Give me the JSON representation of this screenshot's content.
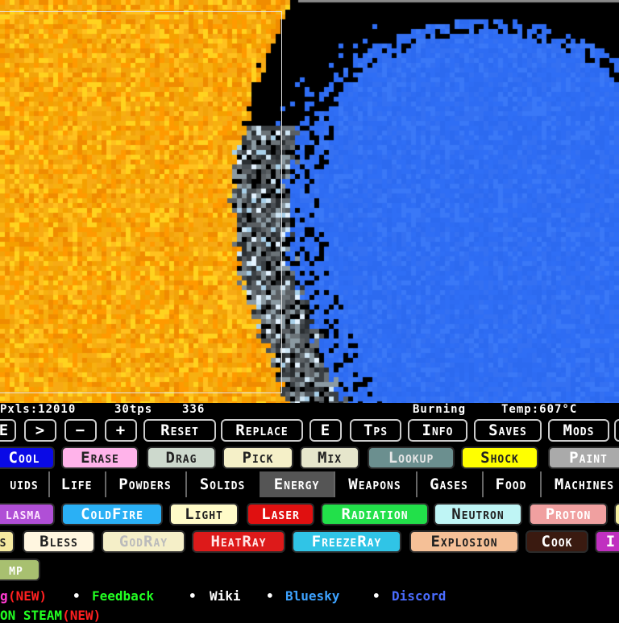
{
  "colors": {
    "fire_orange": "#f5a000",
    "fire_yellow": "#ffd21e",
    "water_blue": "#2f6ef5",
    "smoke_gray": "#5a5f63",
    "ice_light": "#cfe6f5"
  },
  "status": {
    "pixels": "Pxls:12010",
    "tps": "30tps",
    "tick": "336",
    "hover_element": "Burning",
    "temperature": "Temp:607°C"
  },
  "tool_row": {
    "partial_left": "E",
    "next_label": ">",
    "minus_label": "−",
    "plus_label": "+",
    "reset_label": "Reset",
    "replace_label": "Replace",
    "e_label": "E",
    "tps_label": "Tps",
    "info_label": "Info",
    "saves_label": "Saves",
    "mods_label": "Mods"
  },
  "mode_row": [
    {
      "label": "Cool",
      "bg": "#0a0ae6",
      "fg": "#ffffff"
    },
    {
      "label": "Erase",
      "bg": "#ffb3ea",
      "fg": "#222222"
    },
    {
      "label": "Drag",
      "bg": "#cdd9cd",
      "fg": "#222222"
    },
    {
      "label": "Pick",
      "bg": "#f5f0c8",
      "fg": "#222222"
    },
    {
      "label": "Mix",
      "bg": "#e6e6cc",
      "fg": "#222222"
    },
    {
      "label": "Lookup",
      "bg": "#6b8f8f",
      "fg": "#e6e6e6"
    },
    {
      "label": "Shock",
      "bg": "#ffff00",
      "fg": "#222222"
    },
    {
      "label": "Paint",
      "bg": "#aaaaaa",
      "fg": "#ffffff"
    }
  ],
  "categories": [
    {
      "label": "uids"
    },
    {
      "label": "Life"
    },
    {
      "label": "Powders"
    },
    {
      "label": "Solids"
    },
    {
      "label": "Energy",
      "active": true
    },
    {
      "label": "Weapons"
    },
    {
      "label": "Gases"
    },
    {
      "label": "Food"
    },
    {
      "label": "Machines"
    }
  ],
  "energy_row1": [
    {
      "label": "lasma",
      "bg": "#b04fd6",
      "fg": "#ffe6ff"
    },
    {
      "label": "ColdFire",
      "bg": "#2ab0f5",
      "fg": "#ffffff"
    },
    {
      "label": "Light",
      "bg": "#fffbc8",
      "fg": "#222222"
    },
    {
      "label": "Laser",
      "bg": "#e01010",
      "fg": "#ffffff"
    },
    {
      "label": "Radiation",
      "bg": "#22e04a",
      "fg": "#ffffff"
    },
    {
      "label": "Neutron",
      "bg": "#bff5f5",
      "fg": "#222222"
    },
    {
      "label": "Proton",
      "bg": "#f0a0a0",
      "fg": "#ffffff"
    },
    {
      "label": "",
      "bg": "#f5f0a0",
      "fg": "#222222"
    }
  ],
  "energy_row2": [
    {
      "label": "s",
      "bg": "#f5e9a0",
      "fg": "#222222"
    },
    {
      "label": "Bless",
      "bg": "#fff6e0",
      "fg": "#222222"
    },
    {
      "label": "GodRay",
      "bg": "#f5efc8",
      "fg": "#bbbbbb"
    },
    {
      "label": "HeatRay",
      "bg": "#dd1a1a",
      "fg": "#ffe6e6"
    },
    {
      "label": "FreezeRay",
      "bg": "#30c4e6",
      "fg": "#ffffff"
    },
    {
      "label": "Explosion",
      "bg": "#f5c097",
      "fg": "#222222"
    },
    {
      "label": "Cook",
      "bg": "#3a1a10",
      "fg": "#ffffff"
    },
    {
      "label": "I",
      "bg": "#c030c0",
      "fg": "#ffffff"
    }
  ],
  "energy_row3": [
    {
      "label": "mp",
      "bg": "#a8c070",
      "fg": "#ffffff"
    }
  ],
  "links": {
    "changelog_partial": "g",
    "changelog_new": "(NEW)",
    "feedback": "Feedback",
    "wiki": "Wiki",
    "bluesky": "Bluesky",
    "discord": "Discord",
    "bullet": "•",
    "steam_partial": "ON STEAM",
    "steam_new": "(NEW)"
  }
}
